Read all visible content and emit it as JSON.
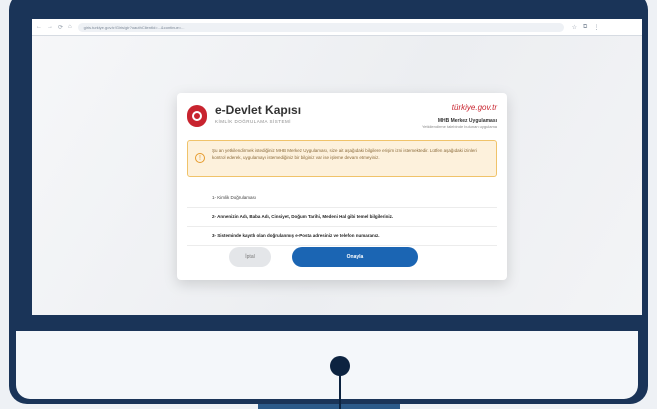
{
  "browser": {
    "url": "giris.turkiye.gov.tr/Giris/gir?oauthClientId=...&continue=...",
    "nav": [
      "←",
      "→",
      "⟳",
      "⌂"
    ],
    "actions": [
      "☆",
      "⧉",
      "⋮"
    ]
  },
  "dialog": {
    "title": "e-Devlet Kapısı",
    "subtitle": "KİMLİK DOĞRULAMA SİSTEMİ",
    "brand_logo": "türkiye.gov.tr",
    "brand_app": "MHB Merkez Uygulaması",
    "brand_sub": "Yetkilendirme talebinde bulunan uygulama",
    "warning": "Şu an yetkilendirmek istediğiniz MHB Merkez Uygulaması, size ait aşağıdaki bilgilere erişim izni istemektedir. Lütfen aşağıdaki izinleri kontrol ederek, uygulamayı istemediğiniz bir bilginiz var ise işleme devam etmeyiniz.",
    "permissions": [
      "1- Kimlik Doğrulaması",
      "2- Annenizin Adı, Baba Adı, Cinsiyet, Doğum Tarihi, Medeni Hal gibi temel bilgileriniz.",
      "3- Sisteminde kayıtlı olan doğrulanmış e-Posta adresiniz ve telefon numaranız."
    ],
    "cancel_label": "İptal",
    "confirm_label": "Onayla"
  },
  "colors": {
    "frame": "#1a3458",
    "brand_red": "#c8242f",
    "confirm_blue": "#1b65b3",
    "warning_bg": "#fdf1dc"
  }
}
